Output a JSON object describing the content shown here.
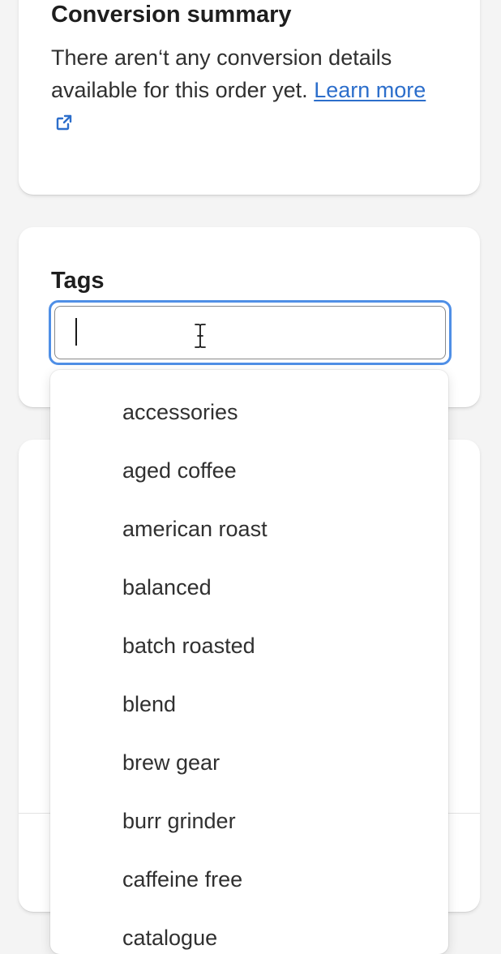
{
  "conversion": {
    "title": "Conversion summary",
    "text": "There aren‘t any conversion details available for this order yet.",
    "link_label": "Learn more"
  },
  "tags": {
    "title": "Tags",
    "input_value": "",
    "options": [
      "accessories",
      "aged coffee",
      "american roast",
      "balanced",
      "batch roasted",
      "blend",
      "brew gear",
      "burr grinder",
      "caffeine free",
      "catalogue"
    ]
  },
  "colors": {
    "page_bg": "#f4f4f4",
    "card_bg": "#ffffff",
    "link": "#2c6ecb",
    "focus_ring": "#4f8fe6"
  },
  "icons": {
    "external_link": "external-link-icon",
    "text_cursor": "text-cursor-icon"
  }
}
